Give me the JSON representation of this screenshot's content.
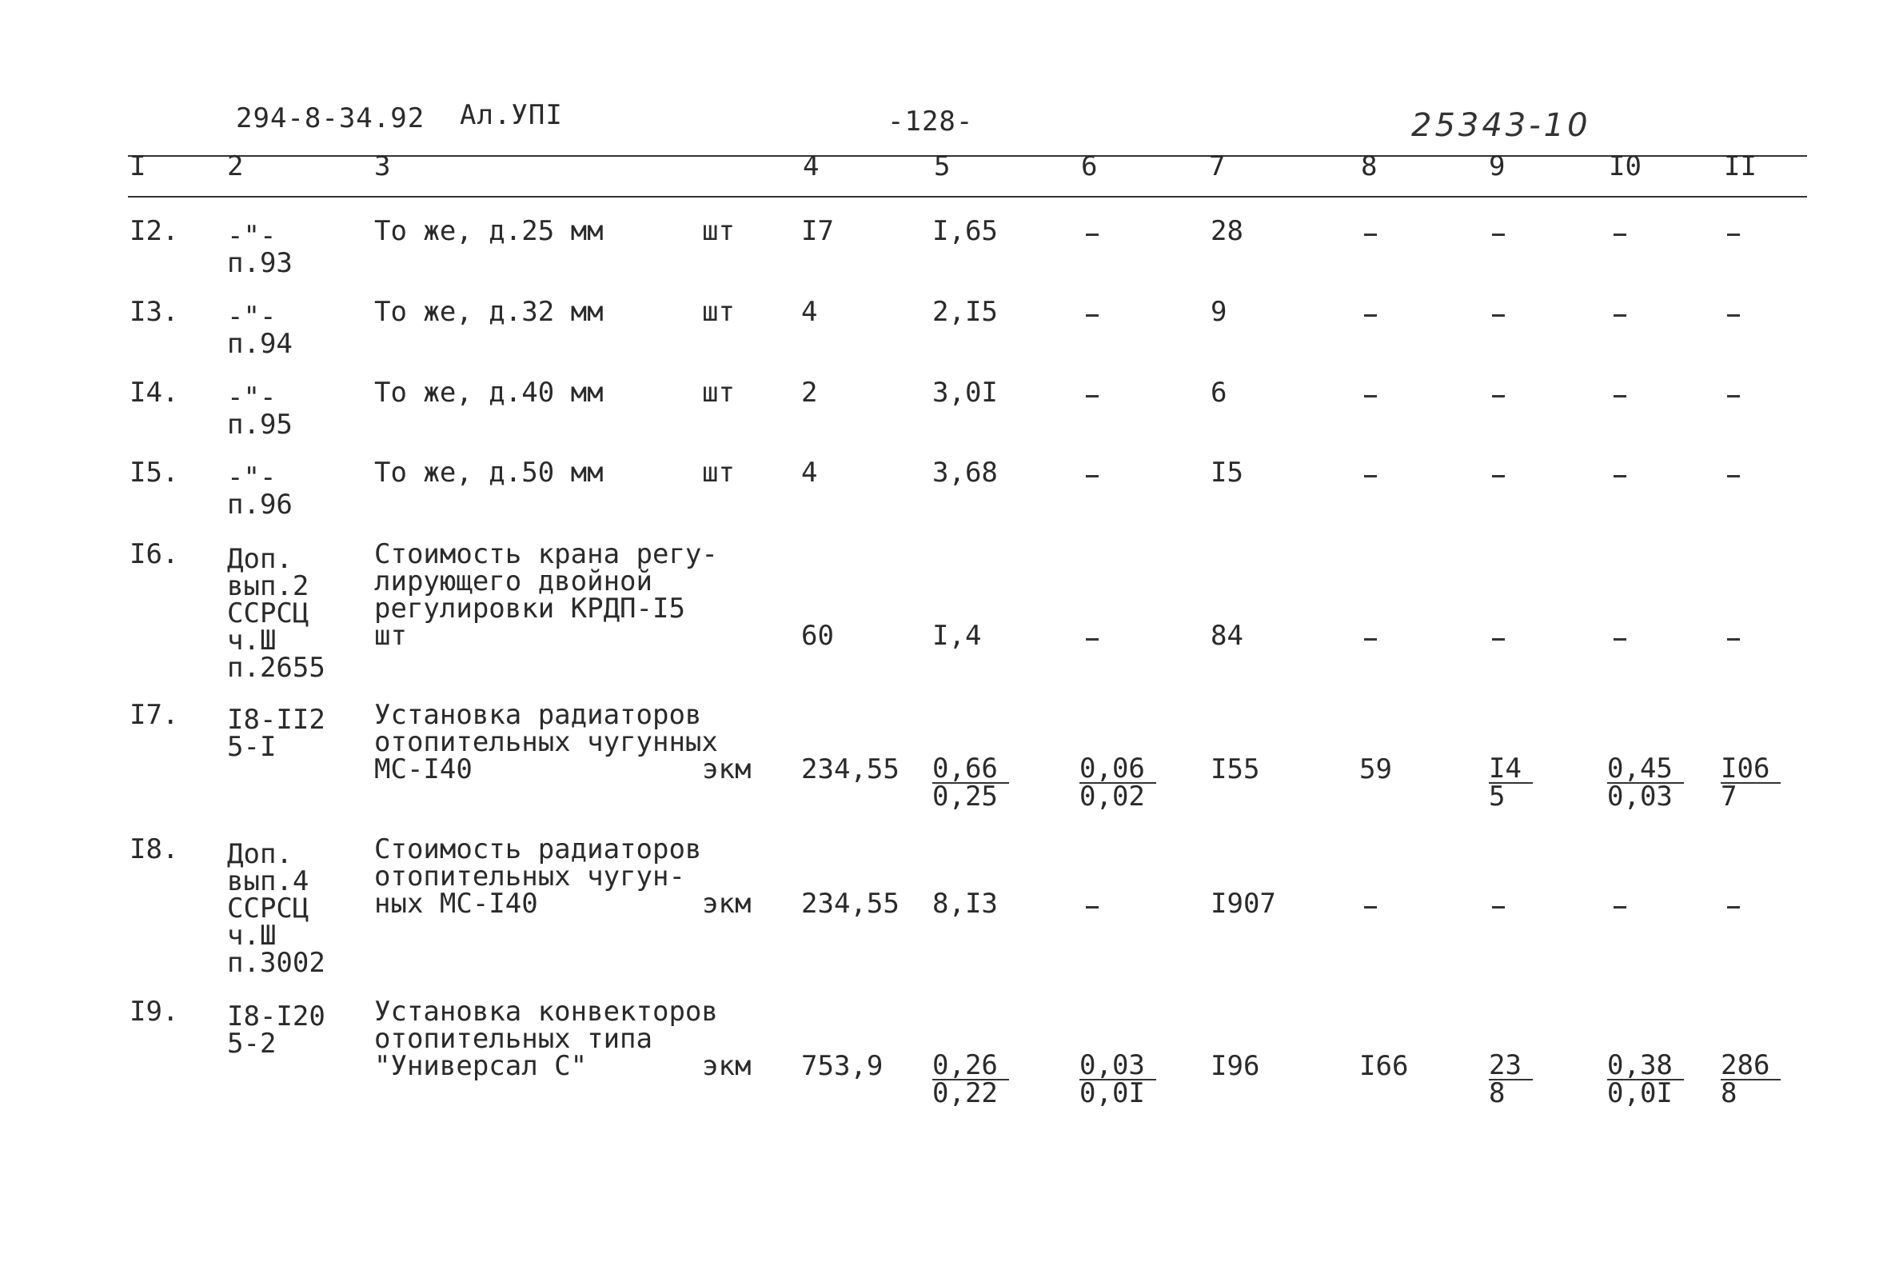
{
  "header": {
    "doc_code": "294-8-34.92",
    "album": "Ал.УПI",
    "page": "-128-",
    "handwritten_number": "25343-10"
  },
  "columns": [
    "I",
    "2",
    "3",
    "4",
    "5",
    "6",
    "7",
    "8",
    "9",
    "I0",
    "II"
  ],
  "rows": [
    {
      "num": "I2.",
      "ref": [
        "-\"-",
        "п.93"
      ],
      "desc": [
        "То же, д.25 мм"
      ],
      "unit": "шт",
      "c4": "I7",
      "c5": "I,65",
      "c6": "-",
      "c7": "28",
      "c8": "-",
      "c9": "-",
      "c10": "-",
      "c11": "-"
    },
    {
      "num": "I3.",
      "ref": [
        "-\"-",
        "п.94"
      ],
      "desc": [
        "То же, д.32 мм"
      ],
      "unit": "шт",
      "c4": "4",
      "c5": "2,I5",
      "c6": "-",
      "c7": "9",
      "c8": "-",
      "c9": "-",
      "c10": "-",
      "c11": "-"
    },
    {
      "num": "I4.",
      "ref": [
        "-\"-",
        "п.95"
      ],
      "desc": [
        "То же, д.40 мм"
      ],
      "unit": "шт",
      "c4": "2",
      "c5": "3,0I",
      "c6": "-",
      "c7": "6",
      "c8": "-",
      "c9": "-",
      "c10": "-",
      "c11": "-"
    },
    {
      "num": "I5.",
      "ref": [
        "-\"-",
        "п.96"
      ],
      "desc": [
        "То же, д.50 мм"
      ],
      "unit": "шт",
      "c4": "4",
      "c5": "3,68",
      "c6": "-",
      "c7": "I5",
      "c8": "-",
      "c9": "-",
      "c10": "-",
      "c11": "-"
    },
    {
      "num": "I6.",
      "ref": [
        "Доп.",
        "вып.2",
        "ССРСЦ",
        "ч.Ш",
        "п.2655"
      ],
      "desc": [
        "Стоимость крана регу-",
        "лирующего двойной",
        "регулировки КРДП-I5",
        "шт"
      ],
      "unit": "",
      "c4": "60",
      "c5": "I,4",
      "c6": "-",
      "c7": "84",
      "c8": "-",
      "c9": "-",
      "c10": "-",
      "c11": "-"
    },
    {
      "num": "I7.",
      "ref": [
        "I8-II2",
        "5-I"
      ],
      "desc": [
        "Установка радиаторов",
        "отопительных чугунных",
        "МС-I40"
      ],
      "unit": "экм",
      "c4": "234,55",
      "c5": {
        "top": "0,66",
        "bottom": "0,25"
      },
      "c6": {
        "top": "0,06",
        "bottom": "0,02"
      },
      "c7": "I55",
      "c8": "59",
      "c9": {
        "top": "I4",
        "bottom": "5"
      },
      "c10": {
        "top": "0,45",
        "bottom": "0,03"
      },
      "c11": {
        "top": "I06",
        "bottom": "7"
      }
    },
    {
      "num": "I8.",
      "ref": [
        "Доп.",
        "вып.4",
        "ССРСЦ",
        "ч.Ш",
        "п.3002"
      ],
      "desc": [
        "Стоимость радиаторов",
        "отопительных чугун-",
        "ных МС-I40"
      ],
      "unit": "экм",
      "c4": "234,55",
      "c5": "8,I3",
      "c6": "-",
      "c7": "I907",
      "c8": "-",
      "c9": "-",
      "c10": "-",
      "c11": "-"
    },
    {
      "num": "I9.",
      "ref": [
        "I8-I20",
        "5-2"
      ],
      "desc": [
        "Установка конвекторов",
        "отопительных типа",
        "\"Универсал С\""
      ],
      "unit": "экм",
      "c4": "753,9",
      "c5": {
        "top": "0,26",
        "bottom": "0,22"
      },
      "c6": {
        "top": "0,03",
        "bottom": "0,0I"
      },
      "c7": "I96",
      "c8": "I66",
      "c9": {
        "top": "23",
        "bottom": "8"
      },
      "c10": {
        "top": "0,38",
        "bottom": "0,0I"
      },
      "c11": {
        "top": "286",
        "bottom": "8"
      }
    }
  ]
}
